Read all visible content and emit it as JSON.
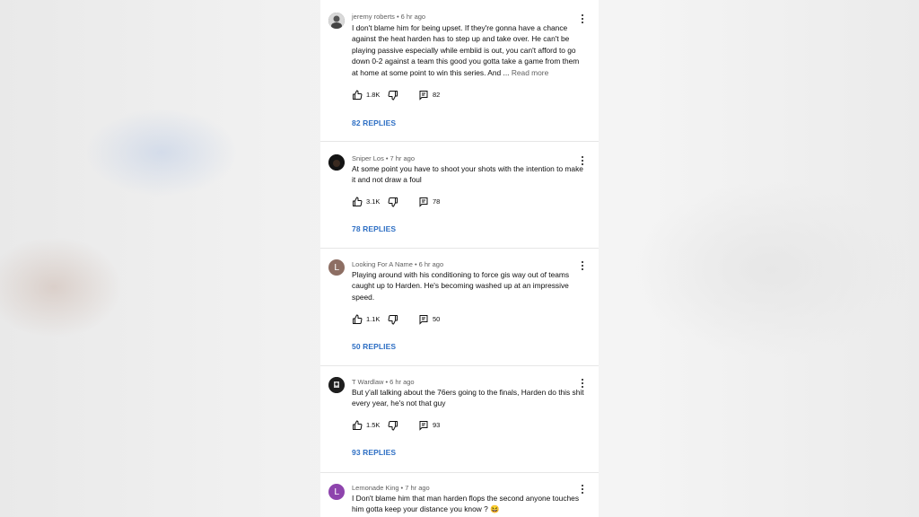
{
  "comments": [
    {
      "author": "jeremy roberts",
      "time": "6 hr ago",
      "text": "I don't blame him for being upset. If they're gonna have a chance against the heat harden has to step up and take over. He can't be playing passive especially while embiid is out, you can't afford to go down 0-2 against a team this good you gotta take a game from them at home at some point to win this series. And ...",
      "read_more": "Read more",
      "likes": "1.8K",
      "reply_count": "82",
      "replies_label": "82 REPLIES",
      "avatar_initial": "",
      "avatar_color": "#6b6b6b"
    },
    {
      "author": "Sniper Los",
      "time": "7 hr ago",
      "text": "At some point you have to shoot your shots with the intention to make it and not draw a foul",
      "read_more": "",
      "likes": "3.1K",
      "reply_count": "78",
      "replies_label": "78 REPLIES",
      "avatar_initial": "",
      "avatar_color": "#1c1c1c"
    },
    {
      "author": "Looking For A Name",
      "time": "6 hr ago",
      "text": "Playing around with his conditioning to force gis way out of teams caught up to Harden. He's becoming washed up at an impressive speed.",
      "read_more": "",
      "likes": "1.1K",
      "reply_count": "50",
      "replies_label": "50 REPLIES",
      "avatar_initial": "L",
      "avatar_color": "#8d6e63"
    },
    {
      "author": "T Wardlaw",
      "time": "6 hr ago",
      "text": "But y'all talking about the 76ers going to the finals, Harden do this shit every year, he's not that guy",
      "read_more": "",
      "likes": "1.5K",
      "reply_count": "93",
      "replies_label": "93 REPLIES",
      "avatar_initial": "",
      "avatar_color": "#2a2a2a"
    },
    {
      "author": "Lemonade King",
      "time": "7 hr ago",
      "text": "I Don't blame him that man harden flops the second anyone touches him gotta keep your distance you know ? 😆",
      "read_more": "",
      "likes": "",
      "reply_count": "",
      "replies_label": "",
      "avatar_initial": "L",
      "avatar_color": "#8e44ad"
    }
  ],
  "icons": {
    "like": "thumb-up-icon",
    "dislike": "thumb-down-icon",
    "reply": "comment-icon",
    "menu": "more-vert-icon"
  },
  "colors": {
    "replies_link": "#2e6fc4",
    "meta_text": "#606060"
  }
}
